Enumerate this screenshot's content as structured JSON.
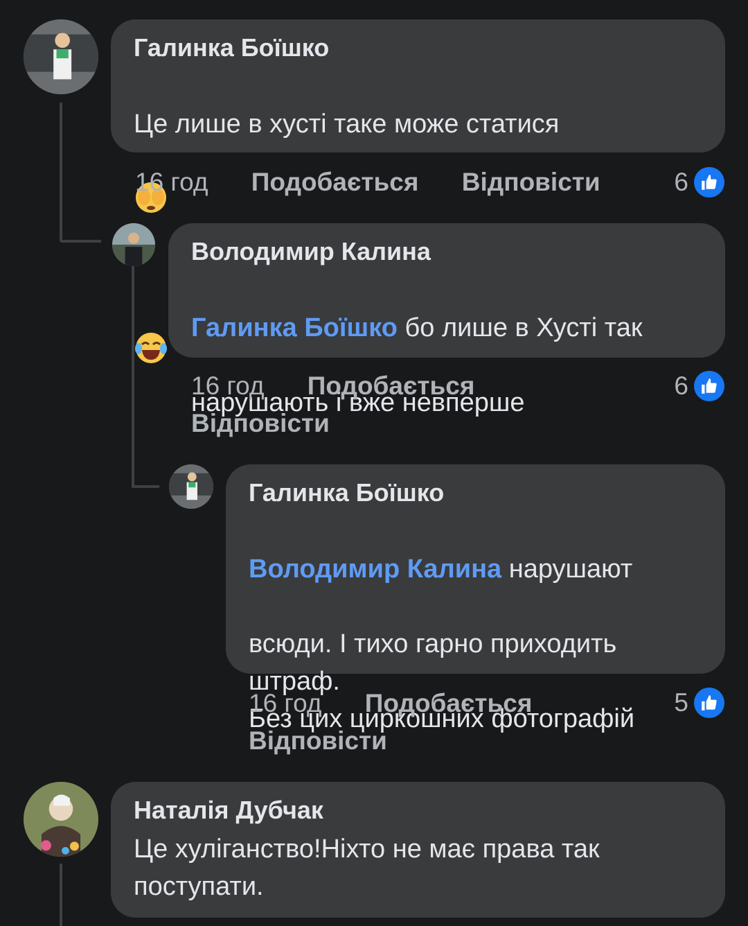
{
  "comments": [
    {
      "author": "Галинка Боїшко",
      "text": "Це лише в хусті таке може статися",
      "time": "16 год",
      "like_label": "Подобається",
      "reply_label": "Відповісти",
      "likes": "6",
      "emojis": [
        "hands-over-eyes-emoji",
        "tears-of-joy-emoji"
      ]
    },
    {
      "author": "Володимир Калина",
      "mention": "Галинка Боїшко",
      "text_line1": " бо лише в Хусті так",
      "text_line2": "нарушають і вже невперше",
      "time": "16 год",
      "like_label": "Подобається",
      "reply_label": "Відповісти",
      "likes": "6"
    },
    {
      "author": "Галинка Боїшко",
      "mention": "Володимир Калина",
      "text_line1": " нарушают",
      "text_rest": "всюди. І тихо гарно приходить\nштраф.\nБез цих циркошних фотографій",
      "time": "16 год",
      "like_label": "Подобається",
      "reply_label": "Відповісти",
      "likes": "5"
    },
    {
      "author": "Наталія Дубчак",
      "text": "Це хуліганство!Ніхто не має права так\nпоступати."
    }
  ],
  "colors": {
    "background": "#18191a",
    "bubble": "#3a3b3c",
    "mention": "#5e9bf5",
    "like_badge": "#1877f2"
  }
}
